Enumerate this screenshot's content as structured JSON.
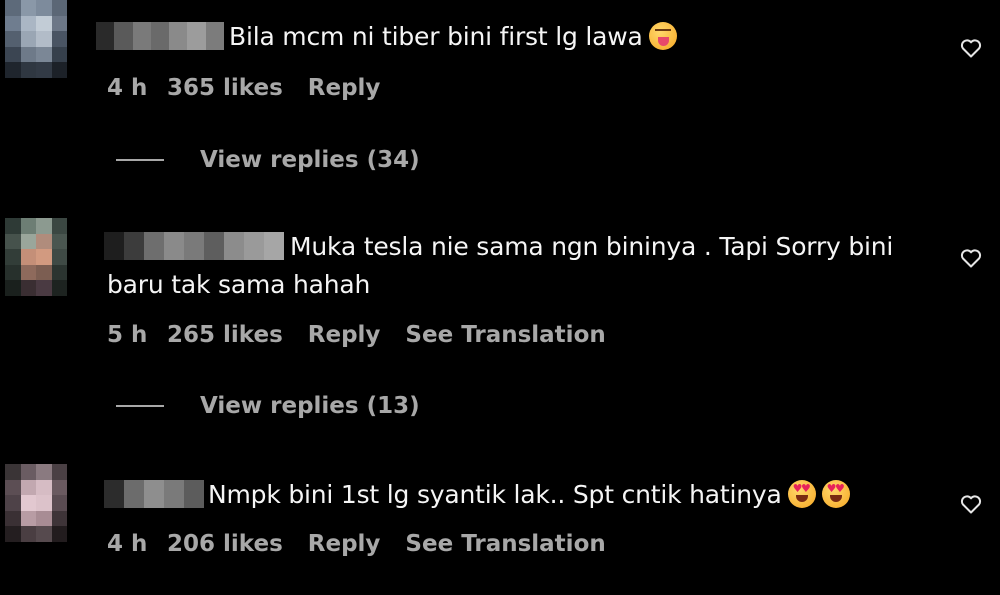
{
  "comments": [
    {
      "text": "Bila mcm ni tiber bini first lg lawa",
      "emoji": "face-with-tongue-emoji",
      "time": "4 h",
      "likes": "365 likes",
      "reply": "Reply",
      "view_replies": "View replies (34)"
    },
    {
      "text_line1": "Muka tesla nie sama ngn bininya . Tapi Sorry bini",
      "text_line2": "baru tak sama hahah",
      "time": "5 h",
      "likes": "265 likes",
      "reply": "Reply",
      "translate": "See Translation",
      "view_replies": "View replies (13)"
    },
    {
      "text": "Nmpk bini 1st lg syantik lak.. Spt cntik hatinya",
      "emoji": "heart-eyes-emoji",
      "time": "4 h",
      "likes": "206 likes",
      "reply": "Reply",
      "translate": "See Translation"
    }
  ],
  "colors": {
    "background": "#000000",
    "text_primary": "#f5f5f5",
    "text_secondary": "#a8a8a8"
  }
}
